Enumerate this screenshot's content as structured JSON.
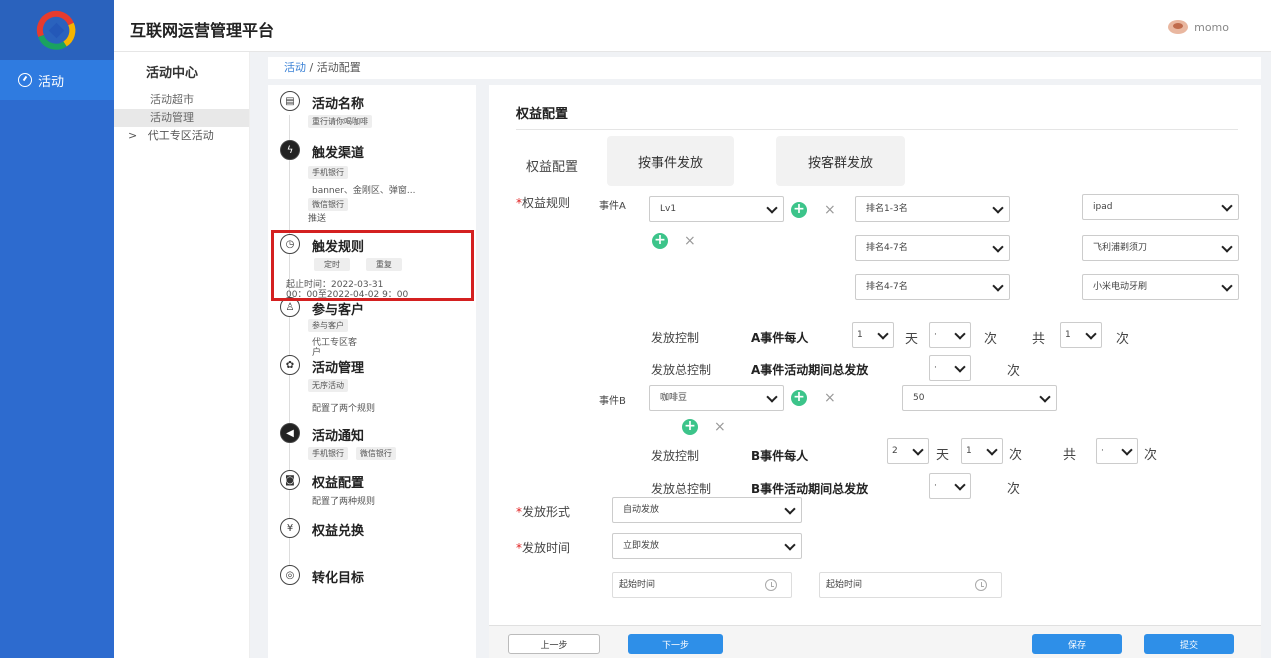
{
  "header": {
    "app_title": "互联网运营管理平台",
    "user_name": "momo"
  },
  "nav": {
    "items": [
      {
        "label": "活动",
        "icon": "gauge-icon"
      }
    ]
  },
  "submenu": {
    "title": "活动中心",
    "items": [
      "活动超市",
      "活动管理"
    ],
    "group": "代工专区活动",
    "group_arrow": ">"
  },
  "breadcrumb": {
    "link": "活动",
    "separator": "/",
    "current": "活动配置"
  },
  "steps": {
    "name": {
      "title": "活动名称",
      "tag": "重行请你喝咖啡"
    },
    "channel": {
      "title": "触发渠道",
      "tag": "手机银行",
      "line1": "banner、金刚区、弹窗...",
      "tag2": "微信银行",
      "line2": "推送"
    },
    "rule": {
      "title": "触发规则",
      "tag1": "定时",
      "tag2": "重复",
      "line1": "起止时间：2022-03-31",
      "line2": "00：00至2022-04-02 9：00"
    },
    "customer": {
      "title": "参与客户",
      "tag": "参与客户",
      "line1": "代工专区客",
      "line2": "户"
    },
    "manage": {
      "title": "活动管理",
      "tag": "无序活动",
      "line1": "配置了两个规则"
    },
    "notice": {
      "title": "活动通知",
      "tag1": "手机银行",
      "tag2": "微信银行"
    },
    "rights": {
      "title": "权益配置",
      "line1": "配置了两种规则"
    },
    "exchange": {
      "title": "权益兑换"
    },
    "target": {
      "title": "转化目标"
    }
  },
  "main": {
    "section_title": "权益配置",
    "config_label": "权益配置",
    "tab_event": "按事件发放",
    "tab_group": "按客群发放",
    "rule_label": "权益规则",
    "required_mark": "*",
    "event_a_label": "事件A",
    "event_a_level": "Lv1",
    "ranks": [
      "排名1-3名",
      "排名4-7名",
      "排名4-7名"
    ],
    "prizes": [
      "ipad",
      "飞利浦剃须刀",
      "小米电动牙刷"
    ],
    "x_mark": "×",
    "plus_mark": "+",
    "issue_control": "发放控制",
    "total_control": "发放总控制",
    "a_each": "A事件每人",
    "a_total": "A事件活动期间总发放",
    "b_each": "B事件每人",
    "b_total": "B事件活动期间总发放",
    "day": "天",
    "times": "次",
    "total": "共",
    "num_1": "1",
    "num_2": "2",
    "num_dot": "·",
    "event_b_label": "事件B",
    "event_b_item": "咖啡豆",
    "event_b_qty": "50",
    "form_label": "发放形式",
    "form_value": "自动发放",
    "time_label": "发放时间",
    "time_value": "立即发放",
    "start_time_1": "起始时间",
    "start_time_2": "起始时间"
  },
  "footer": {
    "prev": "上一步",
    "next": "下一步",
    "save": "保存",
    "submit": "提交"
  }
}
